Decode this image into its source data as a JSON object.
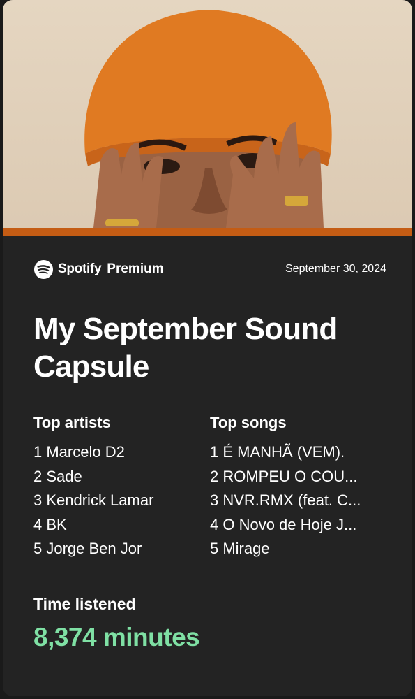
{
  "brand": {
    "name": "Spotify",
    "tier": "Premium",
    "logo_icon": "spotify-logo-icon"
  },
  "date": "September 30, 2024",
  "title": "My September Sound Capsule",
  "top_artists": {
    "heading": "Top artists",
    "items": [
      "1 Marcelo D2",
      "2 Sade",
      "3 Kendrick Lamar",
      "4 BK",
      "5 Jorge Ben Jor"
    ]
  },
  "top_songs": {
    "heading": "Top songs",
    "items": [
      "1 É MANHÃ (VEM).",
      "2 ROMPEU O COU...",
      "3 NVR.RMX (feat. C...",
      "4 O Novo de Hoje J...",
      "5 Mirage"
    ]
  },
  "time_listened": {
    "label": "Time listened",
    "value": "8,374 minutes"
  },
  "colors": {
    "accent_bar": "#c45c14",
    "minutes_green": "#7fe0a4",
    "card_bg": "#232323"
  }
}
